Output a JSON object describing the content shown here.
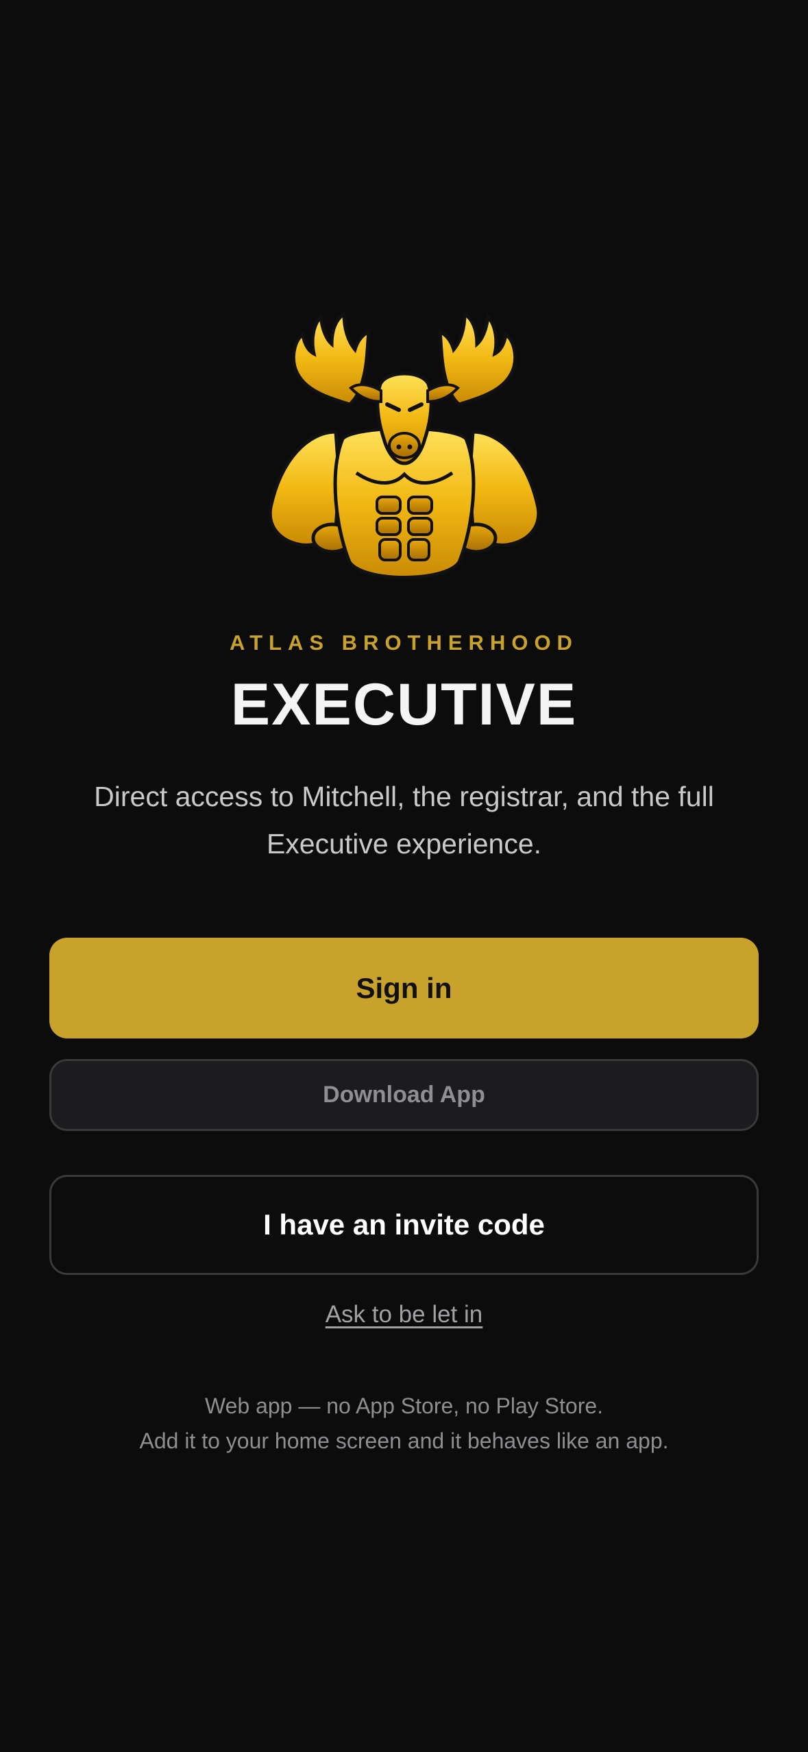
{
  "brand": {
    "eyebrow": "ATLAS BROTHERHOOD",
    "title": "EXECUTIVE",
    "tagline": "Direct access to Mitchell, the registrar, and the full Executive experience.",
    "logo_icon": "muscular-moose-mascot-icon",
    "accent_color": "#c9a22c"
  },
  "actions": {
    "sign_in_label": "Sign in",
    "download_label": "Download App",
    "invite_label": "I have an invite code",
    "ask_label": "Ask to be let in"
  },
  "footer": {
    "line1": "Web app — no App Store, no Play Store.",
    "line2": "Add it to your home screen and it behaves like an app."
  }
}
